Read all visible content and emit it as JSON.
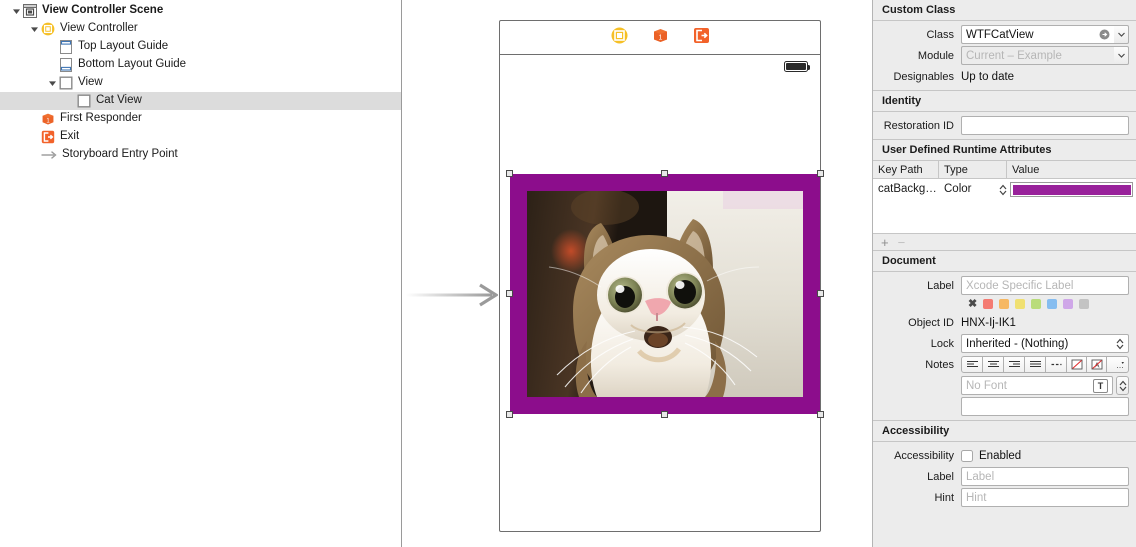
{
  "outline": {
    "name": "document-outline",
    "items": [
      {
        "label": "View Controller Scene",
        "icon": "scene-icon",
        "depth": 0,
        "twisty": "down",
        "bold": true,
        "selected": false
      },
      {
        "label": "View Controller",
        "icon": "view-controller-icon",
        "depth": 1,
        "twisty": "down",
        "bold": false,
        "selected": false
      },
      {
        "label": "Top Layout Guide",
        "icon": "top-layout-guide-icon",
        "depth": 2,
        "twisty": "none",
        "bold": false,
        "selected": false
      },
      {
        "label": "Bottom Layout Guide",
        "icon": "bottom-layout-guide-icon",
        "depth": 2,
        "twisty": "none",
        "bold": false,
        "selected": false
      },
      {
        "label": "View",
        "icon": "view-icon",
        "depth": 2,
        "twisty": "down",
        "bold": false,
        "selected": false
      },
      {
        "label": "Cat View",
        "icon": "view-icon",
        "depth": 3,
        "twisty": "none",
        "bold": false,
        "selected": true
      },
      {
        "label": "First Responder",
        "icon": "first-responder-icon",
        "depth": 1,
        "twisty": "none",
        "bold": false,
        "selected": false
      },
      {
        "label": "Exit",
        "icon": "exit-icon",
        "depth": 1,
        "twisty": "none",
        "bold": false,
        "selected": false
      },
      {
        "label": "Storyboard Entry Point",
        "icon": "entry-point-arrow-icon",
        "depth": 1,
        "twisty": "none",
        "bold": false,
        "selected": false
      }
    ]
  },
  "canvas": {
    "dock_icons": [
      "view-controller-icon",
      "first-responder-icon",
      "exit-icon"
    ],
    "selected_view": {
      "name": "Cat View",
      "background_color": "#8c0d8c",
      "image_alt": "surprised cat photo"
    },
    "entry_arrow": "storyboard-entry-arrow"
  },
  "inspector": {
    "custom_class": {
      "header": "Custom Class",
      "class_label": "Class",
      "class_value": "WTFCatView",
      "module_label": "Module",
      "module_placeholder": "Current – Example",
      "designables_label": "Designables",
      "designables_value": "Up to date"
    },
    "identity": {
      "header": "Identity",
      "restoration_label": "Restoration ID",
      "restoration_value": ""
    },
    "runtime_attributes": {
      "header": "User Defined Runtime Attributes",
      "columns": [
        "Key Path",
        "Type",
        "Value"
      ],
      "rows": [
        {
          "key_path": "catBackg…",
          "type": "Color",
          "value_color": "#99229b"
        }
      ],
      "add_label": "+",
      "remove_label": "−"
    },
    "document": {
      "header": "Document",
      "label_label": "Label",
      "label_placeholder": "Xcode Specific Label",
      "label_value": "",
      "chips": [
        "#4a4a4a",
        "#f47b72",
        "#f6b863",
        "#f0e072",
        "#b9dc7b",
        "#86bdf0",
        "#cfa7e8",
        "#c3c3c3"
      ],
      "object_id_label": "Object ID",
      "object_id_value": "HNX-Ij-IK1",
      "lock_label": "Lock",
      "lock_value": "Inherited - (Nothing)",
      "notes_label": "Notes",
      "notes_buttons": [
        "align-left-icon",
        "align-center-icon",
        "align-right-icon",
        "align-justify-icon",
        "dash-icon",
        "text-color-icon",
        "highlight-color-icon",
        "more-icon"
      ],
      "font_placeholder": "No Font",
      "font_value": "",
      "notes_body_value": ""
    },
    "accessibility": {
      "header": "Accessibility",
      "enabled_label": "Accessibility",
      "enabled_checkbox_text": "Enabled",
      "enabled_checked": false,
      "label_label": "Label",
      "label_placeholder": "Label",
      "label_value": "",
      "hint_label": "Hint",
      "hint_placeholder": "Hint",
      "hint_value": ""
    }
  }
}
